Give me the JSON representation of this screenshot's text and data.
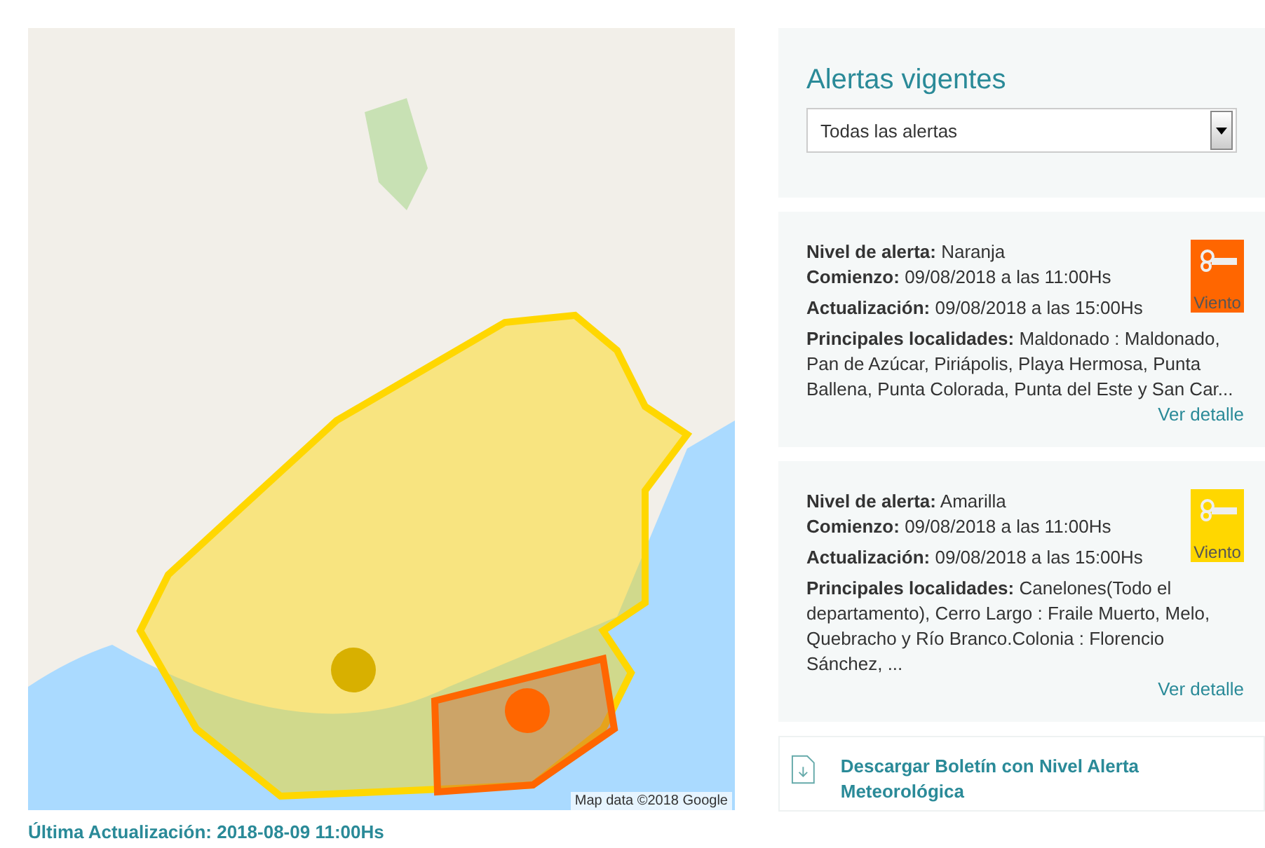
{
  "map": {
    "attribution": "Map data ©2018 Google",
    "last_update": "Última Actualización: 2018-08-09 11:00Hs"
  },
  "sidebar": {
    "title": "Alertas vigentes",
    "filter": {
      "value": "Todas las alertas"
    }
  },
  "alerts": [
    {
      "level_label": "Nivel de alerta:",
      "level": "Naranja",
      "color": "#ff6600",
      "start_label": "Comienzo:",
      "start": "09/08/2018 a las 11:00Hs",
      "update_label": "Actualización:",
      "update": "09/08/2018 a las 15:00Hs",
      "places_label": "Principales localidades:",
      "places": "Maldonado : Maldonado, Pan de Azúcar, Piriápolis, Playa Hermosa, Punta Ballena, Punta Colorada, Punta del Este y San Car...",
      "phenomenon": "Viento",
      "link": "Ver detalle"
    },
    {
      "level_label": "Nivel de alerta:",
      "level": "Amarilla",
      "color": "#ffd700",
      "start_label": "Comienzo:",
      "start": "09/08/2018 a las 11:00Hs",
      "update_label": "Actualización:",
      "update": "09/08/2018 a las 15:00Hs",
      "places_label": "Principales localidades:",
      "places": "Canelones(Todo el departamento), Cerro Largo : Fraile Muerto, Melo, Quebracho y Río Branco.Colonia : Florencio Sánchez, ...",
      "phenomenon": "Viento",
      "link": "Ver detalle"
    }
  ],
  "download": {
    "label": "Descargar Boletín con Nivel Alerta Meteorológica"
  }
}
